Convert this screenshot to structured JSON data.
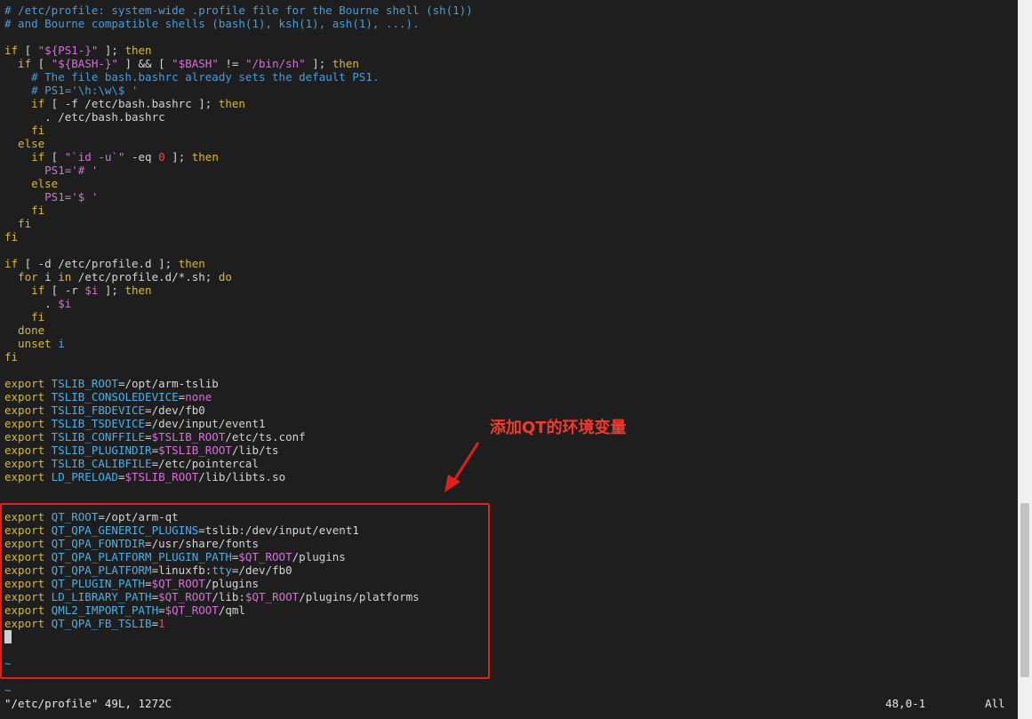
{
  "editor": {
    "lines": [
      [
        {
          "t": "# /etc/profile: system-wide .profile file for the Bourne shell (sh(1))",
          "c": "c"
        }
      ],
      [
        {
          "t": "# and Bourne compatible shells (bash(1), ksh(1), ash(1), ...).",
          "c": "c"
        }
      ],
      [],
      [
        {
          "t": "if",
          "c": "k"
        },
        {
          "t": " [ ",
          "c": ""
        },
        {
          "t": "\"${PS1-}\"",
          "c": "s"
        },
        {
          "t": " ]; ",
          "c": ""
        },
        {
          "t": "then",
          "c": "k"
        }
      ],
      [
        {
          "t": "  if",
          "c": "k"
        },
        {
          "t": " [ ",
          "c": ""
        },
        {
          "t": "\"${BASH-}\"",
          "c": "s"
        },
        {
          "t": " ] && [ ",
          "c": ""
        },
        {
          "t": "\"$BASH\"",
          "c": "s"
        },
        {
          "t": " != ",
          "c": ""
        },
        {
          "t": "\"/bin/sh\"",
          "c": "s"
        },
        {
          "t": " ]; ",
          "c": ""
        },
        {
          "t": "then",
          "c": "k"
        }
      ],
      [
        {
          "t": "    # The file bash.bashrc already sets the default PS1.",
          "c": "c"
        }
      ],
      [
        {
          "t": "    # PS1='\\h:\\w\\$ '",
          "c": "c"
        }
      ],
      [
        {
          "t": "    if",
          "c": "k"
        },
        {
          "t": " [ -f /etc/bash.bashrc ]; ",
          "c": ""
        },
        {
          "t": "then",
          "c": "k"
        }
      ],
      [
        {
          "t": "      . /etc/bash.bashrc",
          "c": ""
        }
      ],
      [
        {
          "t": "    fi",
          "c": "k"
        }
      ],
      [
        {
          "t": "  else",
          "c": "k"
        }
      ],
      [
        {
          "t": "    if",
          "c": "k"
        },
        {
          "t": " [ ",
          "c": ""
        },
        {
          "t": "\"`id -u`\"",
          "c": "s"
        },
        {
          "t": " -eq ",
          "c": ""
        },
        {
          "t": "0",
          "c": "n"
        },
        {
          "t": " ]; ",
          "c": ""
        },
        {
          "t": "then",
          "c": "k"
        }
      ],
      [
        {
          "t": "      PS1=",
          "c": "s"
        },
        {
          "t": "'# '",
          "c": "s"
        }
      ],
      [
        {
          "t": "    else",
          "c": "k"
        }
      ],
      [
        {
          "t": "      PS1=",
          "c": "s"
        },
        {
          "t": "'$ '",
          "c": "s"
        }
      ],
      [
        {
          "t": "    fi",
          "c": "k"
        }
      ],
      [
        {
          "t": "  fi",
          "c": "k"
        }
      ],
      [
        {
          "t": "fi",
          "c": "k"
        }
      ],
      [],
      [
        {
          "t": "if",
          "c": "k"
        },
        {
          "t": " [ -d /etc/profile.d ]; ",
          "c": ""
        },
        {
          "t": "then",
          "c": "k"
        }
      ],
      [
        {
          "t": "  for",
          "c": "k"
        },
        {
          "t": " i ",
          "c": ""
        },
        {
          "t": "in",
          "c": "k"
        },
        {
          "t": " /etc/profile.d/*.sh; ",
          "c": ""
        },
        {
          "t": "do",
          "c": "k"
        }
      ],
      [
        {
          "t": "    if",
          "c": "k"
        },
        {
          "t": " [ -r ",
          "c": ""
        },
        {
          "t": "$i",
          "c": "s"
        },
        {
          "t": " ]; ",
          "c": ""
        },
        {
          "t": "then",
          "c": "k"
        }
      ],
      [
        {
          "t": "      . ",
          "c": ""
        },
        {
          "t": "$i",
          "c": "s"
        }
      ],
      [
        {
          "t": "    fi",
          "c": "k"
        }
      ],
      [
        {
          "t": "  done",
          "c": "k"
        }
      ],
      [
        {
          "t": "  unset",
          "c": "k"
        },
        {
          "t": " i",
          "c": "v"
        }
      ],
      [
        {
          "t": "fi",
          "c": "k"
        }
      ],
      [],
      [
        {
          "t": "export",
          "c": "k"
        },
        {
          "t": " TSLIB_ROOT",
          "c": "v"
        },
        {
          "t": "=/opt/arm-tslib",
          "c": ""
        }
      ],
      [
        {
          "t": "export",
          "c": "k"
        },
        {
          "t": " TSLIB_CONSOLEDEVICE",
          "c": "v"
        },
        {
          "t": "=",
          "c": ""
        },
        {
          "t": "none",
          "c": "s"
        }
      ],
      [
        {
          "t": "export",
          "c": "k"
        },
        {
          "t": " TSLIB_FBDEVICE",
          "c": "v"
        },
        {
          "t": "=/dev/fb0",
          "c": ""
        }
      ],
      [
        {
          "t": "export",
          "c": "k"
        },
        {
          "t": " TSLIB_TSDEVICE",
          "c": "v"
        },
        {
          "t": "=/dev/input/event1",
          "c": ""
        }
      ],
      [
        {
          "t": "export",
          "c": "k"
        },
        {
          "t": " TSLIB_CONFFILE",
          "c": "v"
        },
        {
          "t": "=",
          "c": ""
        },
        {
          "t": "$TSLIB_ROOT",
          "c": "s"
        },
        {
          "t": "/etc/ts.conf",
          "c": ""
        }
      ],
      [
        {
          "t": "export",
          "c": "k"
        },
        {
          "t": " TSLIB_PLUGINDIR",
          "c": "v"
        },
        {
          "t": "=",
          "c": ""
        },
        {
          "t": "$TSLIB_ROOT",
          "c": "s"
        },
        {
          "t": "/lib/ts",
          "c": ""
        }
      ],
      [
        {
          "t": "export",
          "c": "k"
        },
        {
          "t": " TSLIB_CALIBFILE",
          "c": "v"
        },
        {
          "t": "=/etc/pointercal",
          "c": ""
        }
      ],
      [
        {
          "t": "export",
          "c": "k"
        },
        {
          "t": " LD_PRELOAD",
          "c": "v"
        },
        {
          "t": "=",
          "c": ""
        },
        {
          "t": "$TSLIB_ROOT",
          "c": "s"
        },
        {
          "t": "/lib/libts.so",
          "c": ""
        }
      ],
      [],
      [],
      [
        {
          "t": "export",
          "c": "k"
        },
        {
          "t": " QT_ROOT",
          "c": "v"
        },
        {
          "t": "=/opt/arm-qt",
          "c": ""
        }
      ],
      [
        {
          "t": "export",
          "c": "k"
        },
        {
          "t": " QT_QPA_GENERIC_PLUGINS",
          "c": "v"
        },
        {
          "t": "=tslib:/dev/input/event1",
          "c": ""
        }
      ],
      [
        {
          "t": "export",
          "c": "k"
        },
        {
          "t": " QT_QPA_FONTDIR",
          "c": "v"
        },
        {
          "t": "=/usr/share/fonts",
          "c": ""
        }
      ],
      [
        {
          "t": "export",
          "c": "k"
        },
        {
          "t": " QT_QPA_PLATFORM_PLUGIN_PATH",
          "c": "v"
        },
        {
          "t": "=",
          "c": ""
        },
        {
          "t": "$QT_ROOT",
          "c": "s"
        },
        {
          "t": "/plugins",
          "c": ""
        }
      ],
      [
        {
          "t": "export",
          "c": "k"
        },
        {
          "t": " QT_QPA_PLATFORM",
          "c": "v"
        },
        {
          "t": "=linuxfb:",
          "c": ""
        },
        {
          "t": "tty",
          "c": "v"
        },
        {
          "t": "=/dev/fb0",
          "c": ""
        }
      ],
      [
        {
          "t": "export",
          "c": "k"
        },
        {
          "t": " QT_PLUGIN_PATH",
          "c": "v"
        },
        {
          "t": "=",
          "c": ""
        },
        {
          "t": "$QT_ROOT",
          "c": "s"
        },
        {
          "t": "/plugins",
          "c": ""
        }
      ],
      [
        {
          "t": "export",
          "c": "k"
        },
        {
          "t": " LD_LIBRARY_PATH",
          "c": "v"
        },
        {
          "t": "=",
          "c": ""
        },
        {
          "t": "$QT_ROOT",
          "c": "s"
        },
        {
          "t": "/lib:",
          "c": ""
        },
        {
          "t": "$QT_ROOT",
          "c": "s"
        },
        {
          "t": "/plugins/platforms",
          "c": ""
        }
      ],
      [
        {
          "t": "export",
          "c": "k"
        },
        {
          "t": " QML2_IMPORT_PATH",
          "c": "v"
        },
        {
          "t": "=",
          "c": ""
        },
        {
          "t": "$QT_ROOT",
          "c": "s"
        },
        {
          "t": "/qml",
          "c": ""
        }
      ],
      [
        {
          "t": "export",
          "c": "k"
        },
        {
          "t": " QT_QPA_FB_TSLIB",
          "c": "v"
        },
        {
          "t": "=",
          "c": ""
        },
        {
          "t": "1",
          "c": "n"
        }
      ]
    ],
    "tilde": "~"
  },
  "annotation": {
    "text": "添加QT的环境变量",
    "color": "#f03a2e"
  },
  "statusline": {
    "file": "\"/etc/profile\" 49L, 1272C",
    "position": "48,0-1",
    "scroll": "All"
  }
}
